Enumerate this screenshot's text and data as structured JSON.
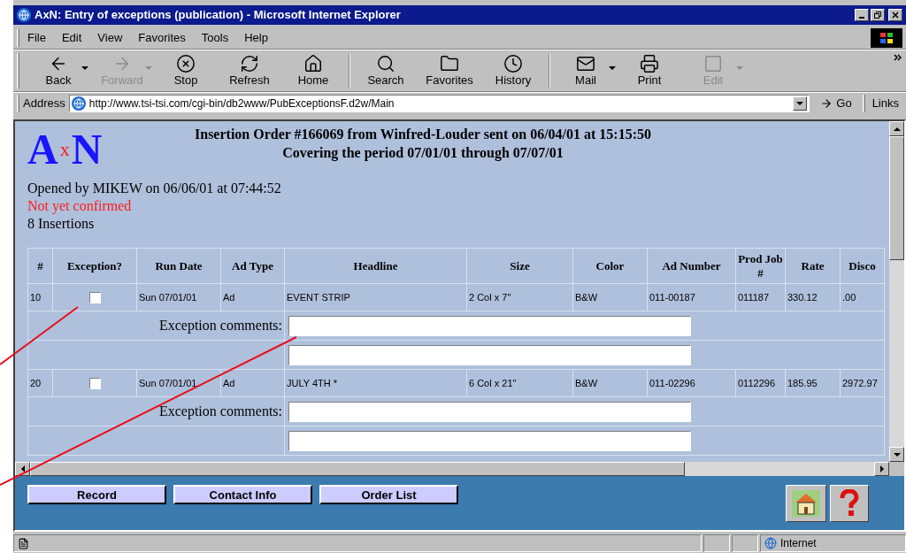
{
  "window": {
    "title": "AxN: Entry of exceptions (publication) - Microsoft Internet Explorer"
  },
  "menu": [
    "File",
    "Edit",
    "View",
    "Favorites",
    "Tools",
    "Help"
  ],
  "toolbar": [
    {
      "label": "Back",
      "disabled": false,
      "dropdown": true
    },
    {
      "label": "Forward",
      "disabled": true,
      "dropdown": true
    },
    {
      "label": "Stop",
      "disabled": false,
      "dropdown": false
    },
    {
      "label": "Refresh",
      "disabled": false,
      "dropdown": false
    },
    {
      "label": "Home",
      "disabled": false,
      "dropdown": false
    },
    {
      "label": "Search",
      "disabled": false,
      "dropdown": false
    },
    {
      "label": "Favorites",
      "disabled": false,
      "dropdown": false
    },
    {
      "label": "History",
      "disabled": false,
      "dropdown": false
    },
    {
      "label": "Mail",
      "disabled": false,
      "dropdown": true
    },
    {
      "label": "Print",
      "disabled": false,
      "dropdown": false
    },
    {
      "label": "Edit",
      "disabled": true,
      "dropdown": true
    }
  ],
  "address": {
    "label": "Address",
    "url": "http://www.tsi-tsi.com/cgi-bin/db2www/PubExceptionsF.d2w/Main",
    "go": "Go",
    "links": "Links"
  },
  "page": {
    "logo": "AxN",
    "heading": [
      "Insertion Order #166069 from Winfred-Louder sent on 06/04/01 at 15:15:50",
      "Covering the period 07/01/01 through 07/07/01"
    ],
    "opened": "Opened by MIKEW on 06/06/01 at 07:44:52",
    "status": "Not yet confirmed",
    "count": "8 Insertions"
  },
  "table": {
    "columns": [
      "#",
      "Exception?",
      "Run Date",
      "Ad Type",
      "Headline",
      "Size",
      "Color",
      "Ad Number",
      "Prod Job #",
      "Rate",
      "Disco"
    ],
    "rows": [
      {
        "exception": false,
        "cells": [
          "10",
          "",
          "Sun 07/01/01",
          "Ad",
          "EVENT STRIP",
          "2 Col x 7\"",
          "B&W",
          "011-00187",
          "011187",
          "330.12",
          ".00"
        ],
        "comment_label": "Exception comments:"
      },
      {
        "exception": false,
        "cells": [
          "20",
          "",
          "Sun 07/01/01",
          "Ad",
          "JULY 4TH *",
          "6 Col x 21\"",
          "B&W",
          "011-02296",
          "0112296",
          "185.95",
          "2972.97"
        ],
        "comment_label": "Exception comments:"
      }
    ]
  },
  "buttons": [
    "Record",
    "Contact Info",
    "Order List"
  ],
  "status_bar": {
    "zone": "Internet"
  }
}
